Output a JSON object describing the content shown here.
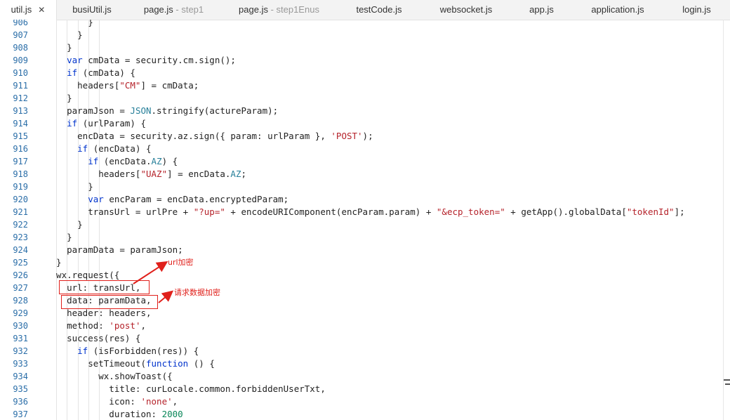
{
  "tabs": [
    {
      "name": "util.js",
      "sub": "",
      "active": true,
      "close": "✕"
    },
    {
      "name": "busiUtil.js",
      "sub": ""
    },
    {
      "name": "page.js",
      "sub": " - step1"
    },
    {
      "name": "page.js",
      "sub": " - step1Enus"
    },
    {
      "name": "testCode.js",
      "sub": ""
    },
    {
      "name": "websocket.js",
      "sub": ""
    },
    {
      "name": "app.js",
      "sub": ""
    },
    {
      "name": "application.js",
      "sub": ""
    },
    {
      "name": "login.js",
      "sub": ""
    }
  ],
  "colors": {
    "annotation": "#e0201b",
    "line_number": "#2b6ea8",
    "keyword": "#0033cc",
    "string": "#b5222a"
  },
  "annotations": {
    "url_note": "url加密",
    "data_note": "请求数据加密"
  },
  "lines": [
    {
      "n": "906",
      "code": "        }"
    },
    {
      "n": "907",
      "code": "      }"
    },
    {
      "n": "908",
      "code": "    }"
    },
    {
      "n": "909",
      "code": "    var cmData = security.cm.sign();"
    },
    {
      "n": "910",
      "code": "    if (cmData) {"
    },
    {
      "n": "911",
      "code": "      headers[\"CM\"] = cmData;"
    },
    {
      "n": "912",
      "code": "    }"
    },
    {
      "n": "913",
      "code": "    paramJson = JSON.stringify(actureParam);"
    },
    {
      "n": "914",
      "code": "    if (urlParam) {"
    },
    {
      "n": "915",
      "code": "      encData = security.az.sign({ param: urlParam }, 'POST');"
    },
    {
      "n": "916",
      "code": "      if (encData) {"
    },
    {
      "n": "917",
      "code": "        if (encData.AZ) {"
    },
    {
      "n": "918",
      "code": "          headers[\"UAZ\"] = encData.AZ;"
    },
    {
      "n": "919",
      "code": "        }"
    },
    {
      "n": "920",
      "code": "        var encParam = encData.encryptedParam;"
    },
    {
      "n": "921",
      "code": "        transUrl = urlPre + \"?up=\" + encodeURIComponent(encParam.param) + \"&ecp_token=\" + getApp().globalData[\"tokenId\"];"
    },
    {
      "n": "922",
      "code": "      }"
    },
    {
      "n": "923",
      "code": "    }"
    },
    {
      "n": "924",
      "code": "    paramData = paramJson;"
    },
    {
      "n": "925",
      "code": "  }"
    },
    {
      "n": "926",
      "code": "  wx.request({"
    },
    {
      "n": "927",
      "code": "    url: transUrl,"
    },
    {
      "n": "928",
      "code": "    data: paramData,"
    },
    {
      "n": "929",
      "code": "    header: headers,"
    },
    {
      "n": "930",
      "code": "    method: 'post',"
    },
    {
      "n": "931",
      "code": "    success(res) {"
    },
    {
      "n": "932",
      "code": "      if (isForbidden(res)) {"
    },
    {
      "n": "933",
      "code": "        setTimeout(function () {"
    },
    {
      "n": "934",
      "code": "          wx.showToast({"
    },
    {
      "n": "935",
      "code": "            title: curLocale.common.forbiddenUserTxt,"
    },
    {
      "n": "936",
      "code": "            icon: 'none',"
    },
    {
      "n": "937",
      "code": "            duration: 2000"
    }
  ]
}
